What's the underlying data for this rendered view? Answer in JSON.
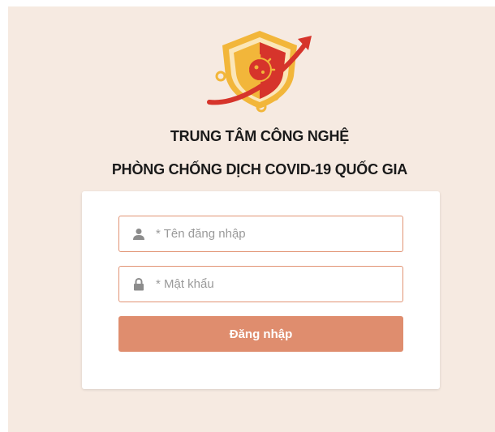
{
  "header": {
    "logo_icon": "covid-shield-logo-icon",
    "title_line_1": "TRUNG TÂM CÔNG NGHỆ",
    "title_line_2": "PHÒNG CHỐNG DỊCH COVID-19 QUỐC GIA"
  },
  "login_form": {
    "username": {
      "icon": "user-icon",
      "placeholder": "* Tên đăng nhập",
      "value": ""
    },
    "password": {
      "icon": "lock-icon",
      "placeholder": "* Mật khẩu",
      "value": ""
    },
    "submit_label": "Đăng nhập"
  },
  "colors": {
    "page_background": "#f6eae1",
    "accent": "#df8d6e",
    "input_border": "#e19374",
    "logo_red": "#d6342b",
    "logo_gold": "#f2b63a"
  }
}
